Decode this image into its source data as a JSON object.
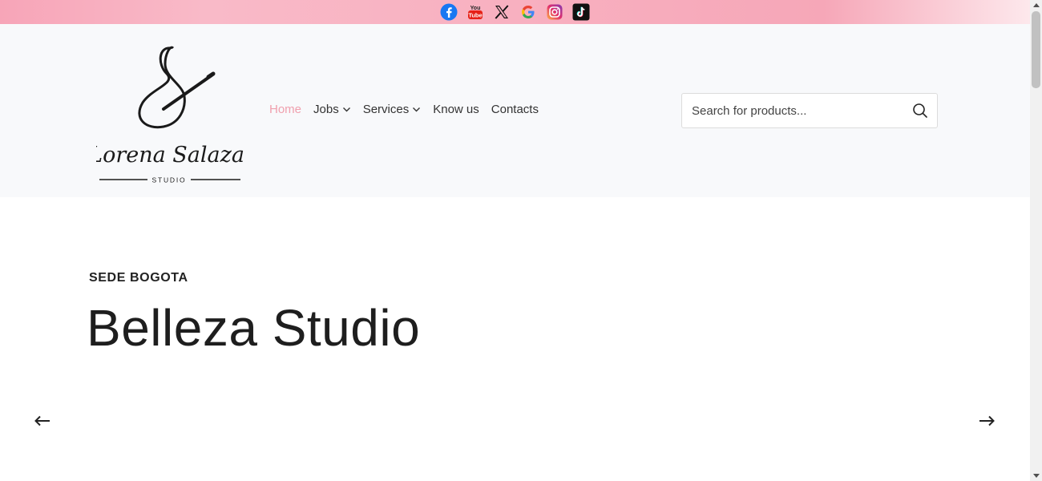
{
  "social": [
    {
      "name": "facebook-icon",
      "color": "#1877f2"
    },
    {
      "name": "youtube-icon",
      "color": "#e62117"
    },
    {
      "name": "x-icon",
      "color": "#000000"
    },
    {
      "name": "google-icon",
      "color": "#4285f4"
    },
    {
      "name": "instagram-icon",
      "color": "#d6249f"
    },
    {
      "name": "tiktok-icon",
      "color": "#000000"
    }
  ],
  "logo": {
    "script_text": "Lorena Salazar",
    "sub_text": "STUDIO"
  },
  "nav": {
    "home": "Home",
    "jobs": "Jobs",
    "services": "Services",
    "know_us": "Know us",
    "contacts": "Contacts"
  },
  "search": {
    "placeholder": "Search for products..."
  },
  "hero": {
    "eyebrow": "SEDE BOGOTA",
    "title": "Belleza Studio"
  },
  "colors": {
    "accent": "#f0a0ae",
    "topbar": "#f7a5b8"
  }
}
